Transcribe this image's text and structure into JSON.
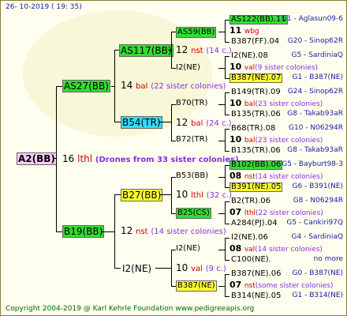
{
  "colors": {
    "green": "#33dd33",
    "yellow": "#ffff33",
    "cyan": "#33ddff",
    "pink": "#ffccff",
    "blue": "#1a1aa0",
    "red": "#cc0000",
    "purple": "#8a2be2",
    "olive": "#006600"
  },
  "header": {
    "date": "26- 10-2019 ( 19: 35)"
  },
  "footer": {
    "copyright": "Copyright 2004-2019 @ Karl Kehrle Foundation   www.pedigreeapis.org"
  },
  "root": {
    "label": "A2(BB)",
    "num": "16",
    "mark": "lthl",
    "note": "(Drones from 33 sister colonies)"
  },
  "l1_top": {
    "label": "AS27(BB)",
    "num": "14",
    "mark": "bal",
    "note": "(22 sister colonies)"
  },
  "l1_bot": {
    "label": "B19(BB)",
    "num": "12",
    "mark": "nst",
    "note": "(14 sister colonies)"
  },
  "l2": {
    "a": {
      "label": "AS117(BB)",
      "num": "12",
      "mark": "nst",
      "note": "(14 c.)"
    },
    "b": {
      "label": "B54(TR)",
      "num": "12",
      "mark": "bal",
      "note": "(24 c.)"
    },
    "c": {
      "label": "B27(BB)",
      "num": "10",
      "mark": "lthl",
      "note": "(32 c.)"
    },
    "d": {
      "label": "I2(NE)",
      "num": "10",
      "mark": "val",
      "note": "(9 c.)"
    }
  },
  "l3": {
    "a1": "AS59(BB)",
    "a2": "I2(NE)",
    "b1": "B70(TR)",
    "b2": "B72(TR)",
    "c1": "B53(BB)",
    "c2": "B25(CS)",
    "d1": "I2(NE)",
    "d2": "B387(NE)"
  },
  "l4": [
    {
      "top": "AS122(BB).11",
      "topinfo": "G1 - Aglasun09-6",
      "num": "11",
      "mark": "wbg",
      "note": "",
      "bot": "B387(FF).04",
      "botinfo": "G20 - Sinop62R"
    },
    {
      "top": "I2(NE).08",
      "topinfo": "G5 - SardiniaQ",
      "num": "10",
      "mark": "val",
      "note": "(9 sister colonies)",
      "bot": "B387(NE).07",
      "botinfo": "G1 - B387(NE)"
    },
    {
      "top": "B149(TR).09",
      "topinfo": "G24 - Sinop62R",
      "num": "10",
      "mark": "bal",
      "note": "(23 sister colonies)",
      "bot": "B135(TR).06",
      "botinfo": "G8 - Takab93aR"
    },
    {
      "top": "B68(TR).08",
      "topinfo": "G10 - N06294R",
      "num": "10",
      "mark": "bal",
      "note": "(23 sister colonies)",
      "bot": "B135(TR).06",
      "botinfo": "G8 - Takab93aR"
    },
    {
      "top": "B102(BB).06",
      "topinfo": "G5 - Bayburt98-3",
      "num": "08",
      "mark": "nst",
      "note": "(14 sister colonies)",
      "bot": "B391(NE).05",
      "botinfo": "G6 - B391(NE)"
    },
    {
      "top": "B2(TR).06",
      "topinfo": "G8 - N06294R",
      "num": "07",
      "mark": "lthl",
      "note": "(22 sister colonies)",
      "bot": "A284(PJ).04",
      "botinfo": "G5 - Cankiri97Q"
    },
    {
      "top": "I2(NE).06",
      "topinfo": "G4 - SardiniaQ",
      "num": "08",
      "mark": "val",
      "note": "(14 sister colonies)",
      "bot": "C100(NE).",
      "botinfo": "no more"
    },
    {
      "top": "B387(NE).06",
      "topinfo": "G0 - B387(NE)",
      "num": "07",
      "mark": "nst",
      "note": "(some sister colonies)",
      "bot": "B314(NE).05",
      "botinfo": "G1 - B314(NE)"
    }
  ]
}
